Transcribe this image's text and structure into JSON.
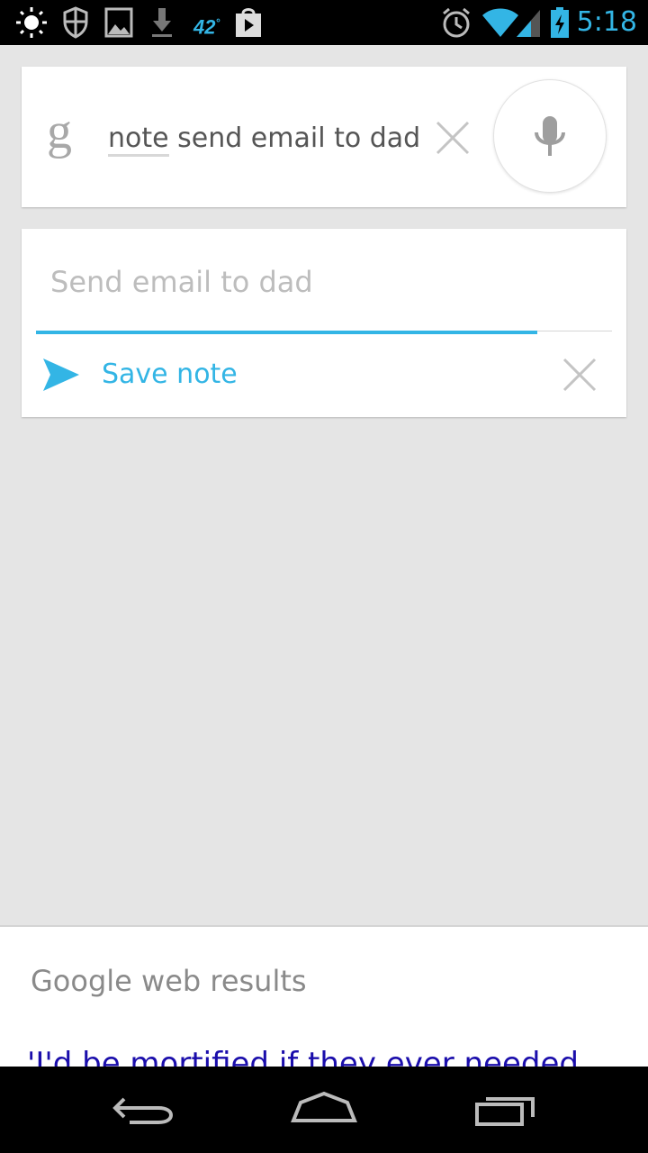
{
  "status_bar": {
    "left_icons": [
      "brightness-icon",
      "shield-icon",
      "image-icon",
      "download-icon"
    ],
    "temperature": "42",
    "temperature_unit": "°",
    "right_icons": [
      "play-store-icon",
      "alarm-icon",
      "wifi-icon",
      "signal-icon",
      "battery-charging-icon"
    ],
    "time": "5:18",
    "accent": "#33b5e5"
  },
  "search": {
    "logo": "g",
    "query_keyword": "note",
    "query_rest": " send email to dad",
    "clear_icon": "close-icon",
    "mic_icon": "microphone-icon"
  },
  "note_card": {
    "placeholder": "Send email to dad",
    "save_label": "Save note",
    "send_icon": "send-icon",
    "cancel_icon": "close-icon",
    "progress": 0.87
  },
  "web_results": {
    "header": "Google web results",
    "first_result": "'I'd be mortified if they ever needed"
  },
  "nav_bar": {
    "buttons": [
      "back-icon",
      "home-icon",
      "recent-apps-icon"
    ]
  }
}
